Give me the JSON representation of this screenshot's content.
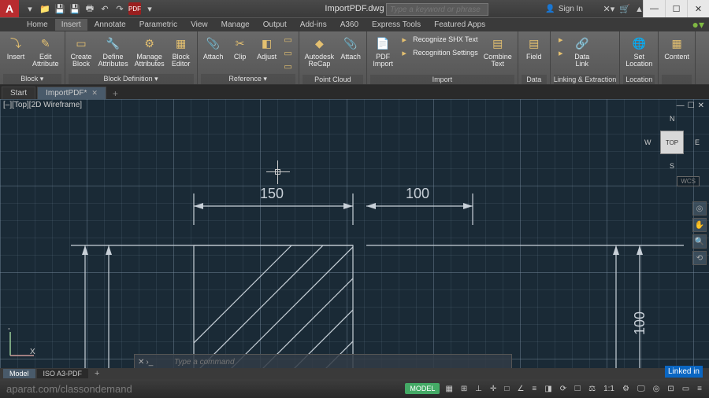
{
  "app": {
    "logo_letter": "A",
    "document": "ImportPDF.dwg",
    "pdf_badge": "PDF"
  },
  "search": {
    "placeholder": "Type a keyword or phrase"
  },
  "signin": {
    "label": "Sign In"
  },
  "win": {
    "min": "—",
    "max": "☐",
    "close": "✕"
  },
  "menu": {
    "tabs": [
      "Home",
      "Insert",
      "Annotate",
      "Parametric",
      "View",
      "Manage",
      "Output",
      "Add-ins",
      "A360",
      "Express Tools",
      "Featured Apps"
    ],
    "active": 1
  },
  "ribbon": {
    "panels": [
      {
        "label": "Block ▾",
        "tools": [
          {
            "icon": "⤵",
            "label": "Insert"
          },
          {
            "icon": "✎",
            "label": "Edit\nAttribute"
          }
        ]
      },
      {
        "label": "Block Definition ▾",
        "tools": [
          {
            "icon": "▭",
            "label": "Create\nBlock"
          },
          {
            "icon": "🔧",
            "label": "Define\nAttributes"
          },
          {
            "icon": "⚙",
            "label": "Manage\nAttributes"
          },
          {
            "icon": "▦",
            "label": "Block\nEditor"
          }
        ]
      },
      {
        "label": "Reference ▾",
        "tools": [
          {
            "icon": "📎",
            "label": "Attach"
          },
          {
            "icon": "✂",
            "label": "Clip"
          },
          {
            "icon": "◧",
            "label": "Adjust"
          }
        ],
        "stack": [
          {
            "icon": "▭",
            "text": ""
          },
          {
            "icon": "▭",
            "text": ""
          },
          {
            "icon": "▭",
            "text": ""
          }
        ]
      },
      {
        "label": "Point Cloud",
        "tools": [
          {
            "icon": "◆",
            "label": "Autodesk\nReCap"
          },
          {
            "icon": "📎",
            "label": "Attach"
          }
        ]
      },
      {
        "label": "Import",
        "tools": [
          {
            "icon": "📄",
            "label": "PDF\nImport"
          }
        ],
        "stack": [
          {
            "icon": "▸",
            "text": "Recognize SHX Text"
          },
          {
            "icon": "▸",
            "text": "Recognition Settings"
          },
          {
            "icon": "▸",
            "text": "Combine\nText"
          }
        ]
      },
      {
        "label": "Data",
        "tools": [
          {
            "icon": "▤",
            "label": "Field"
          }
        ]
      },
      {
        "label": "Linking & Extraction",
        "tools": [
          {
            "icon": "🔗",
            "label": "Data\nLink"
          }
        ],
        "stack": [
          {
            "icon": "▸",
            "text": ""
          },
          {
            "icon": "▸",
            "text": ""
          }
        ]
      },
      {
        "label": "Location",
        "tools": [
          {
            "icon": "🌐",
            "label": "Set\nLocation"
          }
        ]
      },
      {
        "label": "",
        "tools": [
          {
            "icon": "▦",
            "label": "Content"
          }
        ]
      }
    ]
  },
  "filetabs": {
    "items": [
      {
        "label": "Start"
      },
      {
        "label": "ImportPDF*",
        "active": true
      }
    ]
  },
  "viewport": {
    "label": "[–][Top][2D Wireframe]",
    "wcs": "WCS",
    "cube_face": "TOP",
    "dirs": {
      "n": "N",
      "s": "S",
      "e": "E",
      "w": "W"
    }
  },
  "dims": {
    "d1": "150",
    "d2": "100",
    "d3": "100"
  },
  "ucs": {
    "x": "X",
    "y": "Y"
  },
  "cmd": {
    "placeholder": "Type a command"
  },
  "layout": {
    "tabs": [
      "Model",
      "ISO A3-PDF"
    ],
    "active": 0
  },
  "status": {
    "model": "MODEL",
    "scale": "1:1"
  },
  "watermark": {
    "left": "aparat.com/classondemand",
    "right": "Linked in"
  }
}
